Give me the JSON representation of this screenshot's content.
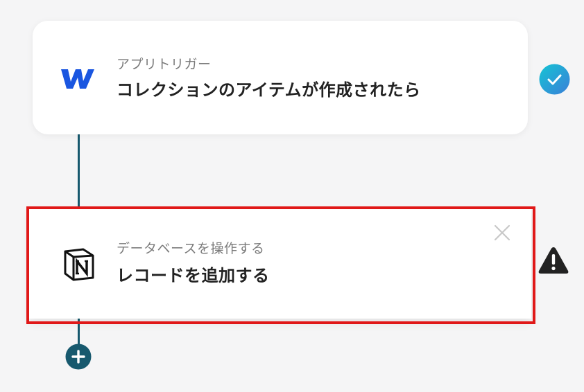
{
  "flow": {
    "steps": [
      {
        "app_icon": "webflow-icon",
        "subtitle": "アプリトリガー",
        "title": "コレクションのアイテムが作成されたら",
        "status_icon": "check-circle-icon",
        "status": "completed"
      },
      {
        "app_icon": "notion-icon",
        "subtitle": "データベースを操作する",
        "title": "レコードを追加する",
        "status_icon": "warning-icon",
        "status": "warning",
        "has_close": true,
        "highlighted": true
      }
    ],
    "add_button_icon": "plus-circle-icon"
  },
  "colors": {
    "connector": "#17596e",
    "highlight": "#e01818",
    "check_gradient_start": "#15c4d4",
    "check_gradient_end": "#3a7fd8",
    "warning": "#222222",
    "webflow": "#1a56e0",
    "add_button": "#17596e"
  }
}
